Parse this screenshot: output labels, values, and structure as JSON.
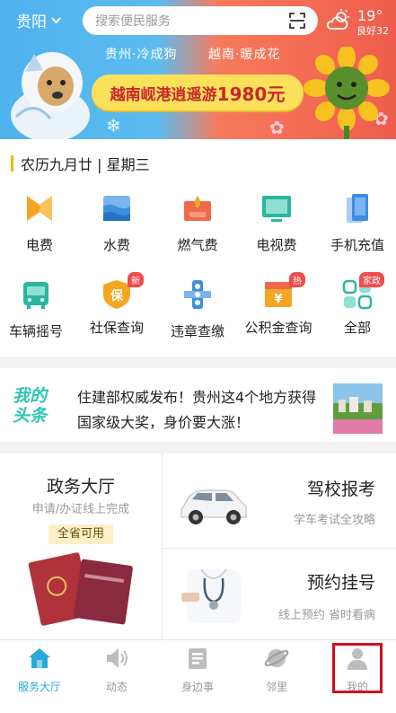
{
  "header": {
    "city": "贵阳",
    "search_placeholder": "搜索便民服务",
    "weather": {
      "temperature": "19°",
      "air_quality": "良好32",
      "icon": "partly-cloudy-icon"
    }
  },
  "banner": {
    "left_caption": "贵州·冷成狗",
    "right_caption": "越南·暖成花",
    "headline": "越南岘港逍遥游",
    "price": "1980元"
  },
  "date_line": "农历九月廿 | 星期三",
  "services": [
    {
      "label": "电费",
      "icon": "electricity-icon",
      "color": "#f4a623"
    },
    {
      "label": "水费",
      "icon": "water-icon",
      "color": "#3d8fe0"
    },
    {
      "label": "燃气费",
      "icon": "gas-icon",
      "color": "#ef6a4a"
    },
    {
      "label": "电视费",
      "icon": "tv-icon",
      "color": "#2ab79f"
    },
    {
      "label": "手机充值",
      "icon": "phone-icon",
      "color": "#3d8fe0"
    },
    {
      "label": "车辆摇号",
      "icon": "bus-icon",
      "color": "#2ab79f"
    },
    {
      "label": "社保查询",
      "icon": "shield-icon",
      "color": "#f4a623",
      "badge": "新"
    },
    {
      "label": "违章查缴",
      "icon": "traffic-light-icon",
      "color": "#3d8fe0"
    },
    {
      "label": "公积金查询",
      "icon": "fund-icon",
      "color": "#f4a623",
      "badge": "热"
    },
    {
      "label": "全部",
      "icon": "grid-icon",
      "color": "#2ab79f",
      "badge": "家政"
    }
  ],
  "news": {
    "logo_line1": "我的",
    "logo_line2": "头条",
    "headline": "住建部权威发布！贵州这4个地方获得国家级大奖，身价要大涨！"
  },
  "cards": {
    "gov_hall": {
      "title": "政务大厅",
      "subtitle": "申请/办证线上完成",
      "tag": "全省可用"
    },
    "driving_school": {
      "title": "驾校报考",
      "subtitle": "学车考试全攻略"
    },
    "appointment": {
      "title": "预约挂号",
      "subtitle": "线上预约 省时看病"
    }
  },
  "tabbar": [
    {
      "label": "服务大厅",
      "icon": "home-icon",
      "active": true
    },
    {
      "label": "动态",
      "icon": "speaker-icon",
      "active": false
    },
    {
      "label": "身边事",
      "icon": "note-icon",
      "active": false
    },
    {
      "label": "邻里",
      "icon": "planet-icon",
      "active": false
    },
    {
      "label": "我的",
      "icon": "person-icon",
      "active": false
    }
  ],
  "colors": {
    "accent": "#2aa8d6",
    "badge": "#f04c4c",
    "highlight_box": "#d0101b"
  }
}
